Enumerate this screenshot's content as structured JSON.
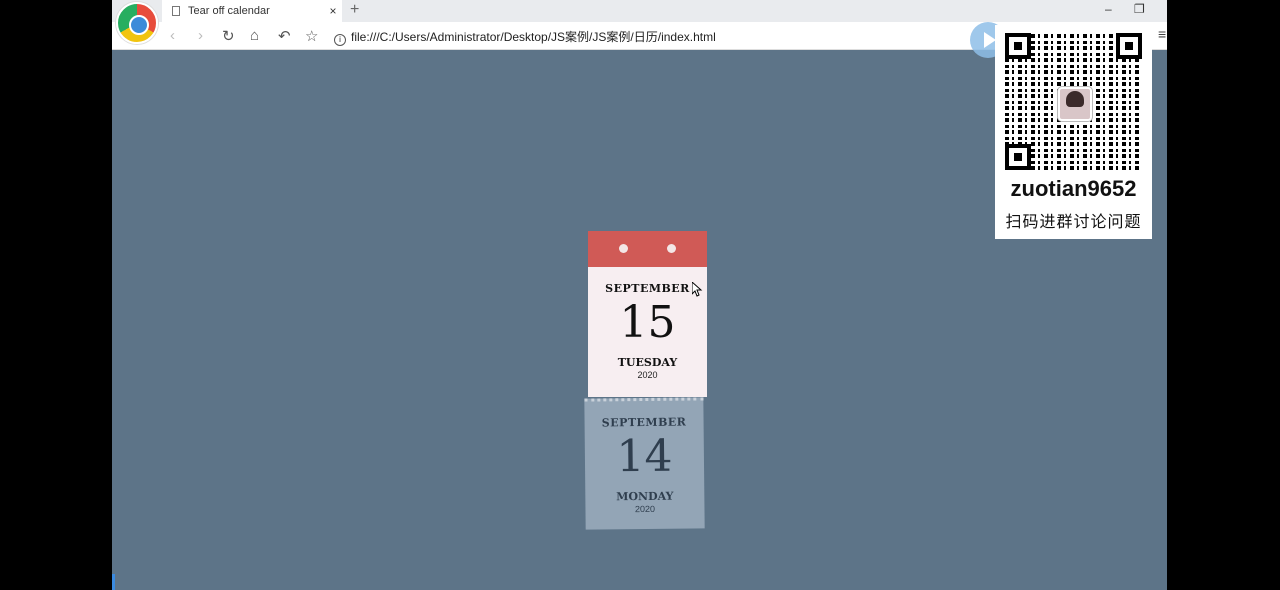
{
  "tab": {
    "title": "Tear off calendar",
    "close": "×",
    "new": "+"
  },
  "window": {
    "minimize": "–",
    "restore": "❐"
  },
  "address": {
    "url": "file:///C:/Users/Administrator/Desktop/JS案例/JS案例/日历/index.html",
    "info": "i"
  },
  "nav": {
    "back": "‹",
    "forward": "›",
    "reload": "↻",
    "home": "⌂",
    "undo": "↶",
    "star": "☆",
    "menu": "≡"
  },
  "promo": {
    "id": "zuotian9652",
    "text": "扫码进群讨论问题"
  },
  "calendar": {
    "current": {
      "month": "SEPTEMBER",
      "day": "15",
      "weekday": "TUESDAY",
      "year": "2020"
    },
    "torn": {
      "month": "SEPTEMBER",
      "day": "14",
      "weekday": "MONDAY",
      "year": "2020"
    }
  }
}
